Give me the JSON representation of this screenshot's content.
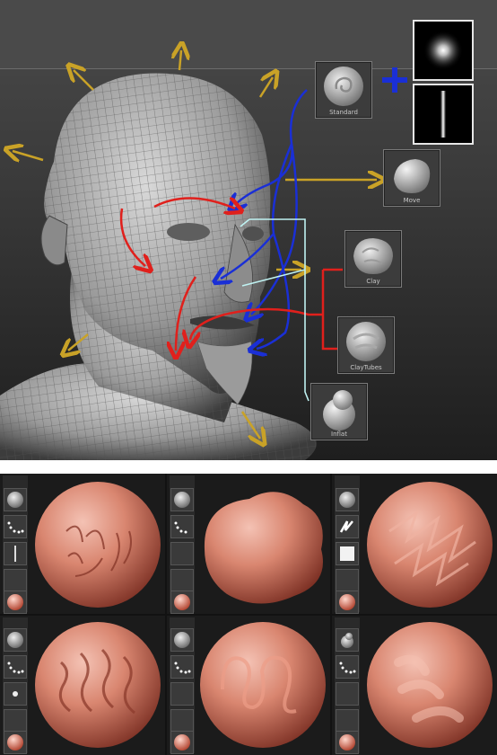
{
  "brushes": [
    {
      "key": "standard",
      "label": "Standard"
    },
    {
      "key": "move",
      "label": "Move"
    },
    {
      "key": "clay",
      "label": "Clay"
    },
    {
      "key": "claytubes",
      "label": "ClayTubes"
    },
    {
      "key": "inflat",
      "label": "Inflat"
    }
  ],
  "colors": {
    "arrow_yellow": "#c9a227",
    "arrow_blue": "#1a2fd6",
    "arrow_red": "#e0201c",
    "arrow_cyan": "#bff2f2",
    "sphere_clay": "#c46a58",
    "background_dark": "#1e1e1e"
  },
  "icons": [
    "plus-icon",
    "alpha-dot-icon",
    "alpha-line-icon",
    "stroke-dots-icon",
    "stroke-zigzag-icon",
    "material-sphere-icon"
  ]
}
